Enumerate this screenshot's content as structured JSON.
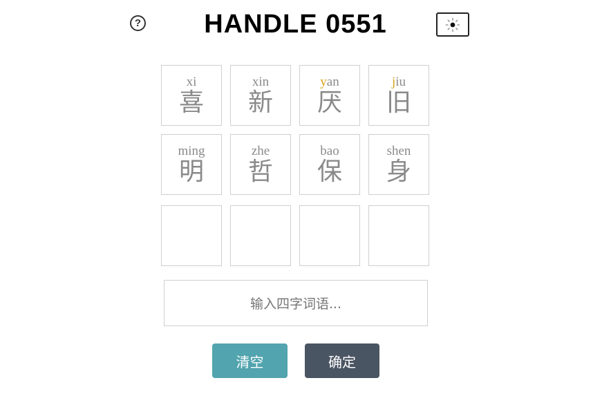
{
  "header": {
    "help_glyph": "?",
    "title": "HANDLE 0551",
    "theme_icon": "sun-icon"
  },
  "grid": {
    "rows": [
      [
        {
          "py_hit": "",
          "py_rest": "xi",
          "hanzi": "喜"
        },
        {
          "py_hit": "",
          "py_rest": "xin",
          "hanzi": "新"
        },
        {
          "py_hit": "y",
          "py_rest": "an",
          "hanzi": "厌"
        },
        {
          "py_hit": "j",
          "py_rest": "iu",
          "hanzi": "旧"
        }
      ],
      [
        {
          "py_hit": "",
          "py_rest": "ming",
          "hanzi": "明"
        },
        {
          "py_hit": "",
          "py_rest": "zhe",
          "hanzi": "哲"
        },
        {
          "py_hit": "",
          "py_rest": "bao",
          "hanzi": "保"
        },
        {
          "py_hit": "",
          "py_rest": "shen",
          "hanzi": "身"
        }
      ],
      [
        {
          "py_hit": "",
          "py_rest": "",
          "hanzi": ""
        },
        {
          "py_hit": "",
          "py_rest": "",
          "hanzi": ""
        },
        {
          "py_hit": "",
          "py_rest": "",
          "hanzi": ""
        },
        {
          "py_hit": "",
          "py_rest": "",
          "hanzi": ""
        }
      ]
    ]
  },
  "input": {
    "placeholder": "输入四字词语..."
  },
  "buttons": {
    "clear_label": "清空",
    "confirm_label": "确定"
  },
  "colors": {
    "present": "#d7a31c",
    "clear_bg": "#52a4ae",
    "confirm_bg": "#4a5563",
    "default_text": "#8a8a8a"
  }
}
